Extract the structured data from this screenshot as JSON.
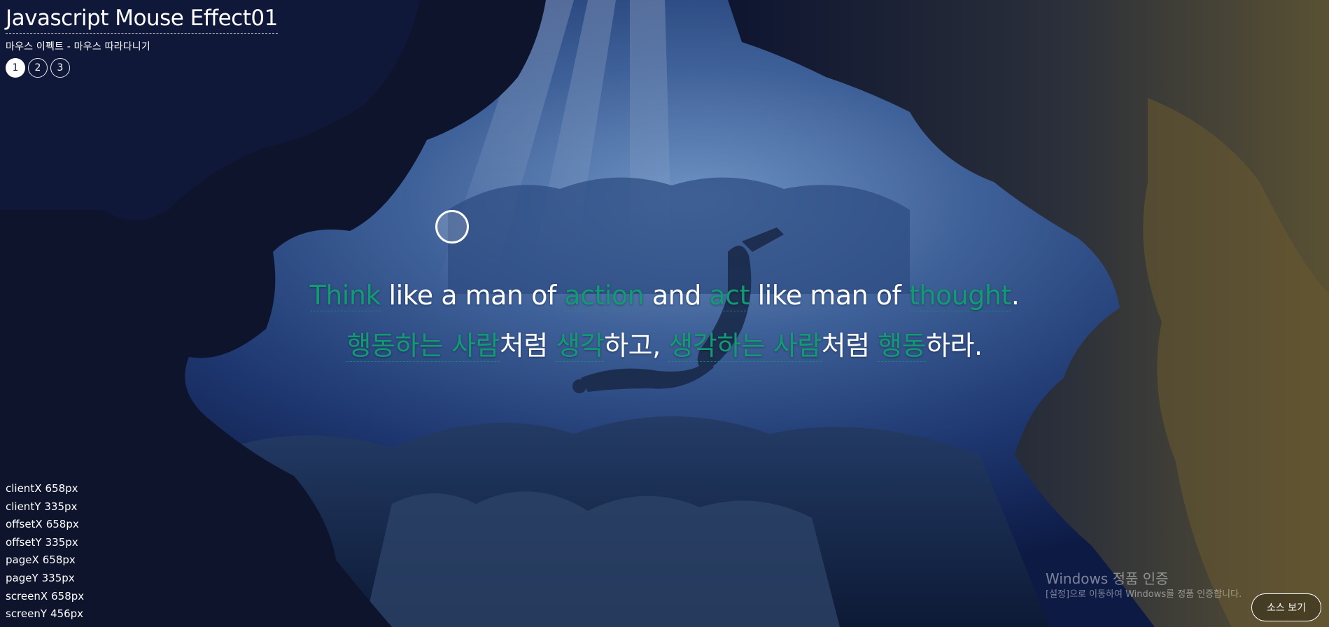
{
  "header": {
    "title": "Javascript Mouse Effect01",
    "subtitle": "마우스 이펙트 - 마우스 따라다니기",
    "pages": [
      "1",
      "2",
      "3"
    ],
    "active_page": "1"
  },
  "quote": {
    "english": [
      {
        "text": "Think",
        "highlight": true
      },
      {
        "text": " like a man of ",
        "highlight": false
      },
      {
        "text": "action",
        "highlight": true
      },
      {
        "text": " and ",
        "highlight": false
      },
      {
        "text": "act",
        "highlight": true
      },
      {
        "text": " like man of ",
        "highlight": false
      },
      {
        "text": "thought",
        "highlight": true
      },
      {
        "text": ".",
        "highlight": false
      }
    ],
    "korean": [
      {
        "text": "행동하는 사람",
        "highlight": true
      },
      {
        "text": "처럼 ",
        "highlight": false
      },
      {
        "text": "생각",
        "highlight": true
      },
      {
        "text": "하고, ",
        "highlight": false
      },
      {
        "text": "생각하는 사람",
        "highlight": true
      },
      {
        "text": "처럼 ",
        "highlight": false
      },
      {
        "text": "행동",
        "highlight": true
      },
      {
        "text": "하라.",
        "highlight": false
      }
    ]
  },
  "mouse_info": [
    {
      "label": "clientX",
      "value": "658px"
    },
    {
      "label": "clientY",
      "value": "335px"
    },
    {
      "label": "offsetX",
      "value": "658px"
    },
    {
      "label": "offsetY",
      "value": "335px"
    },
    {
      "label": "pageX",
      "value": "658px"
    },
    {
      "label": "pageY",
      "value": "335px"
    },
    {
      "label": "screenX",
      "value": "658px"
    },
    {
      "label": "screenY",
      "value": "456px"
    }
  ],
  "watermark": {
    "title": "Windows 정품 인증",
    "description": "[설정]으로 이동하여 Windows를 정품 인증합니다."
  },
  "source_button": {
    "label": "소스 보기"
  },
  "colors": {
    "highlight": "#119a73",
    "text": "#ffffff"
  }
}
